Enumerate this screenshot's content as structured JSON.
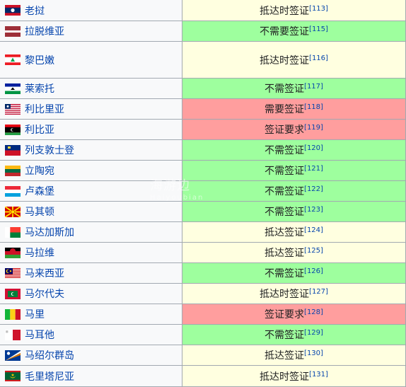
{
  "rows": [
    {
      "country": "老挝",
      "flag": "laos",
      "status": "抵达时签证",
      "ref": "[113]",
      "type": "arr"
    },
    {
      "country": "拉脱维亚",
      "flag": "latvia",
      "status": "不需要签证",
      "ref": "[115]",
      "type": "free"
    },
    {
      "country": "黎巴嫩",
      "flag": "lebanon",
      "status": "抵达时签证",
      "ref": "[116]",
      "type": "arr"
    },
    {
      "country": "莱索托",
      "flag": "lesotho",
      "status": "不需签证",
      "ref": "[117]",
      "type": "free"
    },
    {
      "country": "利比里亚",
      "flag": "liberia",
      "status": "需要签证",
      "ref": "[118]",
      "type": "req"
    },
    {
      "country": "利比亚",
      "flag": "libya",
      "status": "签证要求",
      "ref": "[119]",
      "type": "req"
    },
    {
      "country": "列支敦士登",
      "flag": "liechtenstein",
      "status": "不需签证",
      "ref": "[120]",
      "type": "free"
    },
    {
      "country": "立陶宛",
      "flag": "lithuania",
      "status": "不需签证",
      "ref": "[121]",
      "type": "free"
    },
    {
      "country": "卢森堡",
      "flag": "luxembourg",
      "status": "不需签证",
      "ref": "[122]",
      "type": "free"
    },
    {
      "country": "马其顿",
      "flag": "macedonia",
      "status": "不需签证",
      "ref": "[123]",
      "type": "free"
    },
    {
      "country": "马达加斯加",
      "flag": "madagascar",
      "status": "抵达签证",
      "ref": "[124]",
      "type": "arr"
    },
    {
      "country": "马拉维",
      "flag": "malawi",
      "status": "抵达签证",
      "ref": "[125]",
      "type": "arr"
    },
    {
      "country": "马来西亚",
      "flag": "malaysia",
      "status": "不需签证",
      "ref": "[126]",
      "type": "free"
    },
    {
      "country": "马尔代夫",
      "flag": "maldives",
      "status": "抵达时签证",
      "ref": "[127]",
      "type": "arr"
    },
    {
      "country": "马里",
      "flag": "mali",
      "status": "签证要求",
      "ref": "[128]",
      "type": "req"
    },
    {
      "country": "马耳他",
      "flag": "malta",
      "status": "不需签证",
      "ref": "[129]",
      "type": "free"
    },
    {
      "country": "马绍尔群岛",
      "flag": "marshall",
      "status": "抵达签证",
      "ref": "[130]",
      "type": "arr"
    },
    {
      "country": "毛里塔尼亚",
      "flag": "mauritania",
      "status": "抵达时签证",
      "ref": "[131]",
      "type": "arr"
    }
  ],
  "watermark": {
    "title": "海游边",
    "subtitle": "Haiyoubian"
  }
}
